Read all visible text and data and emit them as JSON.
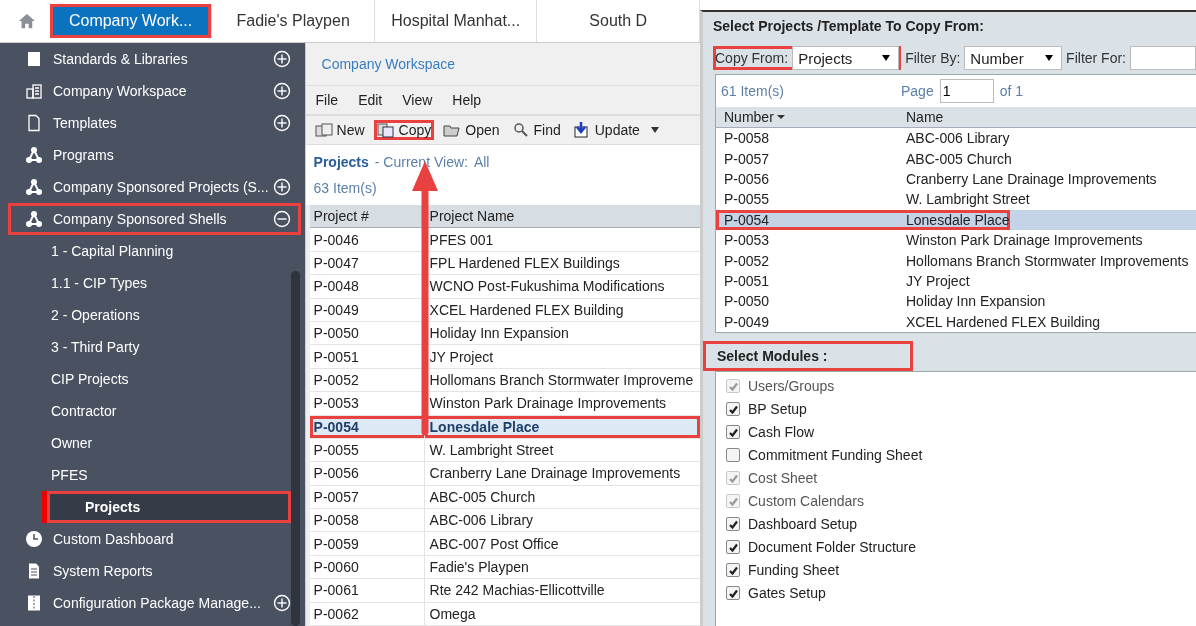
{
  "tabs": [
    {
      "label": "Company Work...",
      "selected": true,
      "annotated": true
    },
    {
      "label": "Fadie's Playpen",
      "selected": false,
      "annotated": false
    },
    {
      "label": "Hospital Manhat...",
      "selected": false,
      "annotated": false
    },
    {
      "label": "South D",
      "selected": false,
      "annotated": false
    }
  ],
  "sidebar": {
    "items": [
      {
        "label": "Standards & Libraries",
        "kind": "book",
        "expanded": false,
        "selected": false,
        "annotated": false
      },
      {
        "label": "Company Workspace",
        "kind": "building",
        "expanded": false,
        "selected": false,
        "annotated": false
      },
      {
        "label": "Templates",
        "kind": "document",
        "expanded": false,
        "selected": false,
        "annotated": false
      },
      {
        "label": "Programs",
        "kind": "network",
        "selected": false,
        "annotated": false
      },
      {
        "label": "Company Sponsored Projects (S...",
        "kind": "network",
        "expanded": false,
        "selected": false,
        "annotated": false
      },
      {
        "label": "Company Sponsored Shells",
        "kind": "network",
        "expanded": true,
        "selected": false,
        "annotated": true,
        "children": [
          {
            "label": "1 - Capital Planning",
            "selected": false,
            "annotated": false
          },
          {
            "label": "1.1 - CIP Types",
            "selected": false,
            "annotated": false
          },
          {
            "label": "2 - Operations",
            "selected": false,
            "annotated": false
          },
          {
            "label": "3 - Third Party",
            "selected": false,
            "annotated": false
          },
          {
            "label": "CIP Projects",
            "selected": false,
            "annotated": false
          },
          {
            "label": "Contractor",
            "selected": false,
            "annotated": false
          },
          {
            "label": "Owner",
            "selected": false,
            "annotated": false
          },
          {
            "label": "PFES",
            "selected": false,
            "annotated": false
          },
          {
            "label": "Projects",
            "selected": true,
            "annotated": true
          }
        ]
      },
      {
        "label": "Custom Dashboard",
        "kind": "clock",
        "selected": false,
        "annotated": false
      },
      {
        "label": "System Reports",
        "kind": "report",
        "selected": false,
        "annotated": false
      },
      {
        "label": "Configuration Package Manage...",
        "kind": "package",
        "expanded": false,
        "selected": false,
        "annotated": false
      }
    ]
  },
  "breadcrumb": "Company Workspace",
  "menu": [
    "File",
    "Edit",
    "View",
    "Help"
  ],
  "toolbar": [
    {
      "label": "New",
      "kind": "new",
      "annotated": false
    },
    {
      "label": "Copy",
      "kind": "copy",
      "annotated": true
    },
    {
      "label": "Open",
      "kind": "folder",
      "annotated": false
    },
    {
      "label": "Find",
      "kind": "search",
      "annotated": false
    },
    {
      "label": "Update",
      "kind": "update",
      "annotated": false
    }
  ],
  "view": {
    "title": "Projects",
    "label": "- Current View:",
    "value": "All"
  },
  "count": "63  Item(s)",
  "table": {
    "columns": [
      "Project #",
      "Project Name"
    ],
    "rows": [
      {
        "number": "P-0046",
        "name": "PFES 001",
        "selected": false,
        "annotated": false
      },
      {
        "number": "P-0047",
        "name": "FPL Hardened FLEX Buildings",
        "selected": false,
        "annotated": false
      },
      {
        "number": "P-0048",
        "name": "WCNO Post-Fukushima Modifications",
        "selected": false,
        "annotated": false
      },
      {
        "number": "P-0049",
        "name": "XCEL Hardened FLEX Building",
        "selected": false,
        "annotated": false
      },
      {
        "number": "P-0050",
        "name": "Holiday Inn Expansion",
        "selected": false,
        "annotated": false
      },
      {
        "number": "P-0051",
        "name": "JY Project",
        "selected": false,
        "annotated": false
      },
      {
        "number": "P-0052",
        "name": "Hollomans Branch Stormwater Improveme",
        "selected": false,
        "annotated": false
      },
      {
        "number": "P-0053",
        "name": "Winston Park Drainage Improvements",
        "selected": false,
        "annotated": false
      },
      {
        "number": "P-0054",
        "name": "Lonesdale Place",
        "selected": true,
        "annotated": true
      },
      {
        "number": "P-0055",
        "name": "W. Lambright Street",
        "selected": false,
        "annotated": false
      },
      {
        "number": "P-0056",
        "name": "Cranberry Lane Drainage Improvements",
        "selected": false,
        "annotated": false
      },
      {
        "number": "P-0057",
        "name": "ABC-005 Church",
        "selected": false,
        "annotated": false
      },
      {
        "number": "P-0058",
        "name": "ABC-006 Library",
        "selected": false,
        "annotated": false
      },
      {
        "number": "P-0059",
        "name": "ABC-007 Post Office",
        "selected": false,
        "annotated": false
      },
      {
        "number": "P-0060",
        "name": "Fadie's Playpen",
        "selected": false,
        "annotated": false
      },
      {
        "number": "P-0061",
        "name": "Rte 242 Machias-Ellicottville",
        "selected": false,
        "annotated": false
      },
      {
        "number": "P-0062",
        "name": "Omega",
        "selected": false,
        "annotated": false
      }
    ]
  },
  "copy_panel": {
    "title": "Select Projects /Template To Copy From:",
    "copy_from": {
      "label": "Copy From:",
      "value": "Projects",
      "annotated": true
    },
    "filter_by": {
      "label": "Filter By:",
      "value": "Number"
    },
    "filter_for": {
      "label": "Filter For:"
    },
    "count": "61  Item(s)",
    "page": {
      "label": "Page",
      "value": "1",
      "of": "of  1"
    },
    "columns": [
      "Number",
      "Name"
    ],
    "rows": [
      {
        "number": "P-0058",
        "name": "ABC-006 Library",
        "selected": false,
        "annotated": false
      },
      {
        "number": "P-0057",
        "name": "ABC-005 Church",
        "selected": false,
        "annotated": false
      },
      {
        "number": "P-0056",
        "name": "Cranberry Lane Drainage Improvements",
        "selected": false,
        "annotated": false
      },
      {
        "number": "P-0055",
        "name": "W. Lambright Street",
        "selected": false,
        "annotated": false
      },
      {
        "number": "P-0054",
        "name": "Lonesdale Place",
        "selected": true,
        "annotated": true
      },
      {
        "number": "P-0053",
        "name": "Winston Park Drainage Improvements",
        "selected": false,
        "annotated": false
      },
      {
        "number": "P-0052",
        "name": "Hollomans Branch Stormwater Improvements",
        "selected": false,
        "annotated": false
      },
      {
        "number": "P-0051",
        "name": "JY Project",
        "selected": false,
        "annotated": false
      },
      {
        "number": "P-0050",
        "name": "Holiday Inn Expansion",
        "selected": false,
        "annotated": false
      },
      {
        "number": "P-0049",
        "name": "XCEL Hardened FLEX Building",
        "selected": false,
        "annotated": false
      }
    ]
  },
  "modules": {
    "title": "Select Modules :",
    "annotated": true,
    "items": [
      {
        "label": "Users/Groups",
        "checked": true,
        "disabled": true
      },
      {
        "label": "BP Setup",
        "checked": true,
        "disabled": false
      },
      {
        "label": "Cash Flow",
        "checked": true,
        "disabled": false
      },
      {
        "label": "Commitment Funding Sheet",
        "checked": false,
        "disabled": false
      },
      {
        "label": "Cost Sheet",
        "checked": true,
        "disabled": true
      },
      {
        "label": "Custom Calendars",
        "checked": true,
        "disabled": true
      },
      {
        "label": "Dashboard Setup",
        "checked": true,
        "disabled": false
      },
      {
        "label": "Document Folder Structure",
        "checked": true,
        "disabled": false
      },
      {
        "label": "Funding Sheet",
        "checked": true,
        "disabled": false
      },
      {
        "label": "Gates Setup",
        "checked": true,
        "disabled": false
      }
    ]
  }
}
